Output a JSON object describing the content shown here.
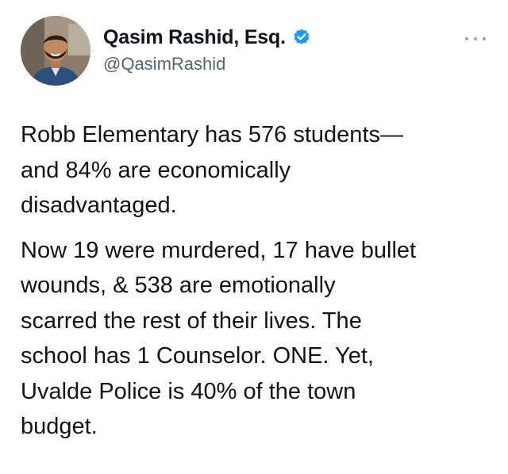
{
  "author": {
    "display_name": "Qasim Rashid, Esq.",
    "handle": "@QasimRashid",
    "verified": true,
    "avatar_icon": "profile-photo"
  },
  "more_icon": "ellipsis-icon",
  "tweet": {
    "paragraphs": [
      "Robb Elementary has 576 students—\nand 84% are economically\ndisadvantaged.",
      "Now 19 were murdered, 17 have bullet\nwounds, & 538 are emotionally\nscarred the rest of their lives. The\nschool has 1 Counselor. ONE. Yet,\nUvalde Police is 40% of the town\nbudget."
    ]
  },
  "colors": {
    "text": "#0f1419",
    "secondary_text": "#536471",
    "verified_blue": "#1d9bf0"
  }
}
